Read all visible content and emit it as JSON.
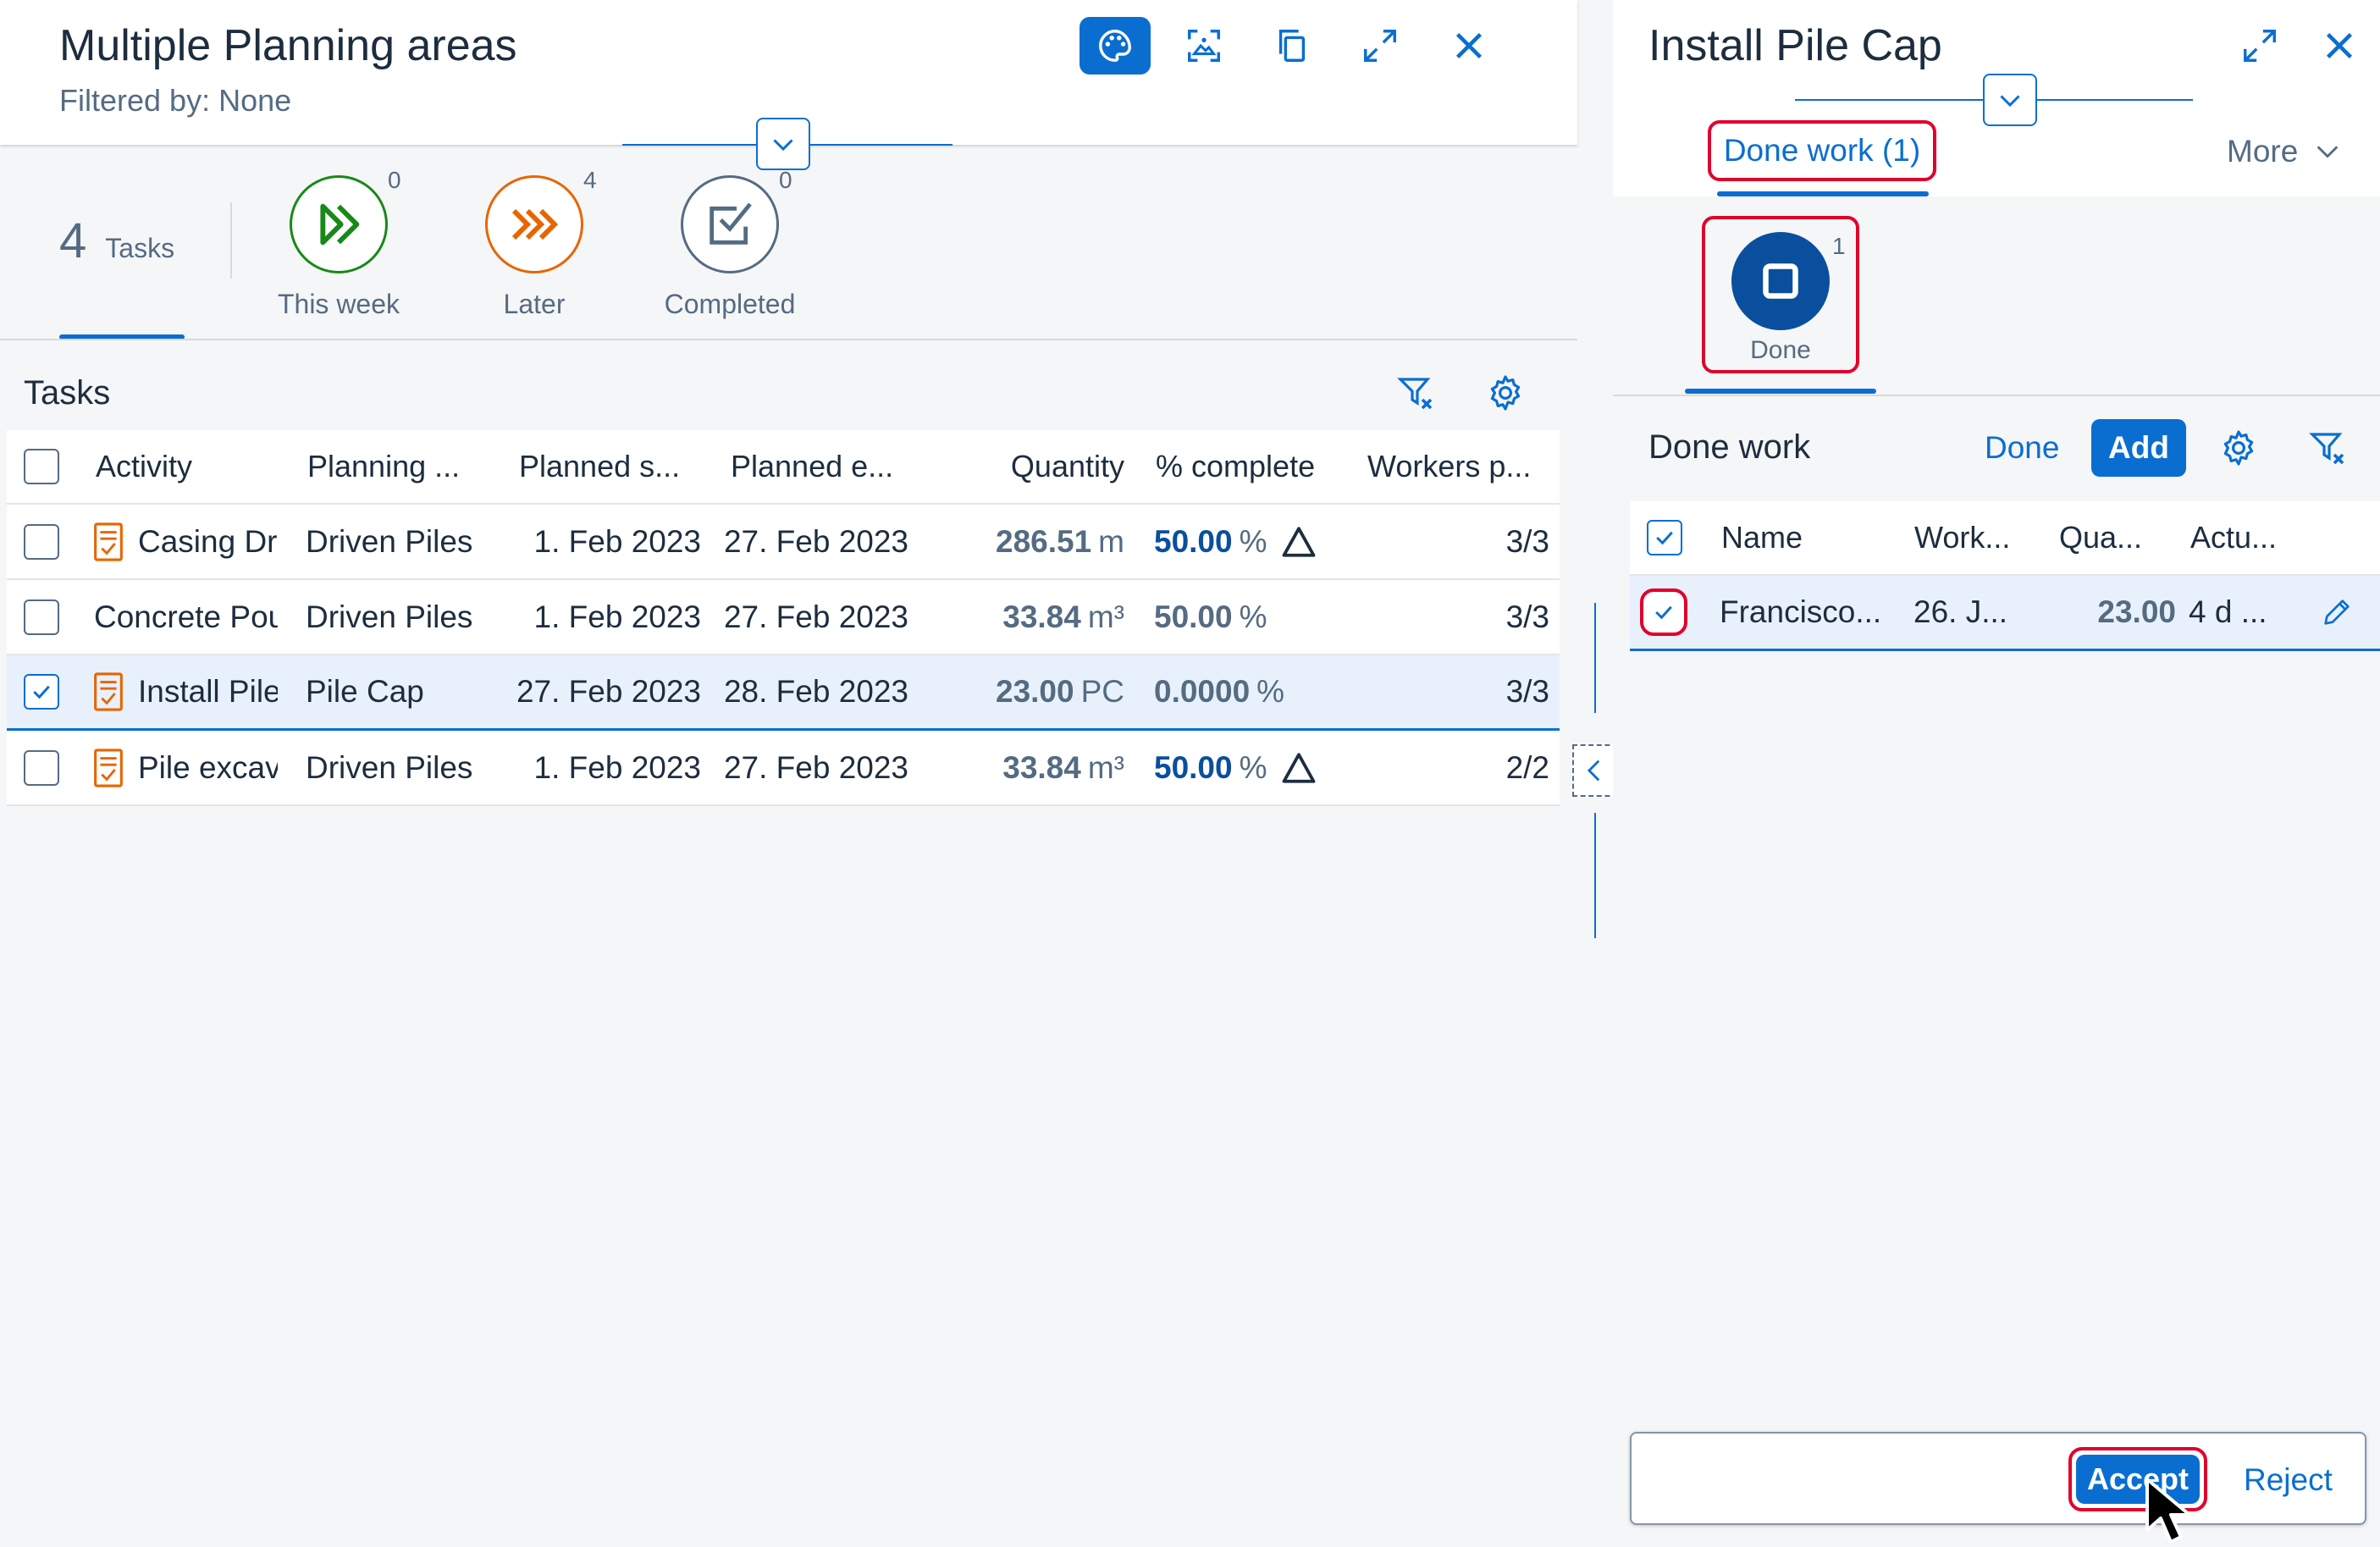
{
  "left": {
    "title": "Multiple Planning areas",
    "subtitle": "Filtered by: None",
    "kpi": {
      "tasks_count": "4",
      "tasks_label": "Tasks",
      "items": [
        {
          "label": "This week",
          "count": "0",
          "color": "#188918",
          "icon": "double-chevron-right-icon"
        },
        {
          "label": "Later",
          "count": "4",
          "color": "#e76500",
          "icon": "triple-chevron-right-icon"
        },
        {
          "label": "Completed",
          "count": "0",
          "color": "#556b82",
          "icon": "checkbox-checked-icon"
        }
      ]
    },
    "tasks_title": "Tasks",
    "columns": [
      "Activity",
      "Planning ...",
      "Planned s...",
      "Planned e...",
      "Quantity",
      "% complete",
      "Workers p..."
    ],
    "rows": [
      {
        "activity": "Casing Dr",
        "planning": "Driven Piles",
        "start": "1. Feb 2023",
        "end": "27. Feb 2023",
        "qty": "286.51",
        "unit": "m",
        "pct": "50.00",
        "pct_unit": "%",
        "workers": "3/3"
      },
      {
        "activity": "Concrete Pou",
        "planning": "Driven Piles",
        "start": "1. Feb 2023",
        "end": "27. Feb 2023",
        "qty": "33.84",
        "unit": "m³",
        "pct": "50.00",
        "pct_unit": "%",
        "workers": "3/3"
      },
      {
        "activity": "Install Pile",
        "planning": "Pile Cap",
        "start": "27. Feb 2023",
        "end": "28. Feb 2023",
        "qty": "23.00",
        "unit": "PC",
        "pct": "0.0000",
        "pct_unit": "%",
        "workers": "3/3"
      },
      {
        "activity": "Pile excav",
        "planning": "Driven Piles",
        "start": "1. Feb 2023",
        "end": "27. Feb 2023",
        "qty": "33.84",
        "unit": "m³",
        "pct": "50.00",
        "pct_unit": "%",
        "workers": "2/2"
      }
    ]
  },
  "right": {
    "title": "Install Pile Cap",
    "tab_done_work": "Done work (1)",
    "more": "More",
    "done_label": "Done",
    "done_count": "1",
    "section_title": "Done work",
    "done_button": "Done",
    "add_button": "Add",
    "columns": [
      "Name",
      "Work...",
      "Qua...",
      "Actu..."
    ],
    "row": {
      "name": "Francisco...",
      "work": "26. J...",
      "qty": "23.00",
      "actual": "4 d ..."
    },
    "accept": "Accept",
    "reject": "Reject"
  },
  "colors": {
    "accent": "#0a6ed1",
    "highlight": "#e0002d",
    "positive": "#188918",
    "warning": "#e76500"
  }
}
